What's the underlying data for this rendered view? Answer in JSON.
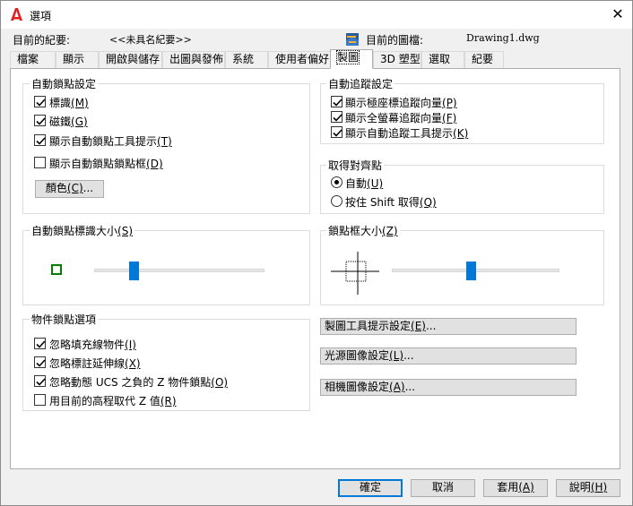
{
  "window": {
    "title": "選項",
    "close_glyph": "✕"
  },
  "header": {
    "profile_label": "目前的紀要:",
    "profile_value": "<<未具名紀要>>",
    "drawing_label": "目前的圖檔:",
    "drawing_value": "Drawing1.dwg"
  },
  "tabs": [
    {
      "label": "檔案"
    },
    {
      "label": "顯示"
    },
    {
      "label": "開啟與儲存"
    },
    {
      "label": "出圖與發佈"
    },
    {
      "label": "系統"
    },
    {
      "label": "使用者偏好"
    },
    {
      "label": "製圖"
    },
    {
      "label": "3D 塑型"
    },
    {
      "label": "選取"
    },
    {
      "label": "紀要"
    }
  ],
  "active_tab": "製圖",
  "autosnap": {
    "title": "自動鎖點設定",
    "options": [
      {
        "text": "標識",
        "key": "(M)",
        "checked": true
      },
      {
        "text": "磁鐵",
        "key": "(G)",
        "checked": true
      },
      {
        "text": "顯示自動鎖點工具提示",
        "key": "(T)",
        "checked": true
      },
      {
        "text": "顯示自動鎖點鎖點框",
        "key": "(D)",
        "checked": false
      }
    ],
    "color_button": {
      "text": "顏色",
      "key": "(C)",
      "suffix": "..."
    }
  },
  "autotrack": {
    "title": "自動追蹤設定",
    "options": [
      {
        "text": "顯示極座標追蹤向量",
        "key": "(P)",
        "checked": true
      },
      {
        "text": "顯示全螢幕追蹤向量",
        "key": "(F)",
        "checked": true
      },
      {
        "text": "顯示自動追蹤工具提示",
        "key": "(K)",
        "checked": true
      }
    ]
  },
  "alignment": {
    "title": "取得對齊點",
    "options": [
      {
        "text": "自動",
        "key": "(U)",
        "selected": true
      },
      {
        "text": "按住 Shift 取得",
        "key": "(Q)",
        "selected": false
      }
    ]
  },
  "marker_size": {
    "title_text": "自動鎖點標識大小",
    "title_key": "(S)",
    "value": 0.23,
    "marker_color": "#008000"
  },
  "aperture_size": {
    "title_text": "鎖點框大小",
    "title_key": "(Z)",
    "value": 0.47
  },
  "osnap": {
    "title": "物件鎖點選項",
    "options": [
      {
        "text": "忽略填充線物件",
        "key": "(I)",
        "checked": true
      },
      {
        "text": "忽略標註延伸線",
        "key": "(X)",
        "checked": true
      },
      {
        "text": "忽略動態 UCS 之負的 Z 物件鎖點",
        "key": "(O)",
        "checked": true
      },
      {
        "text": "用目前的高程取代 Z 值",
        "key": "(R)",
        "checked": false
      }
    ]
  },
  "settings_buttons": [
    {
      "text": "製圖工具提示設定",
      "key": "(E)",
      "suffix": "..."
    },
    {
      "text": "光源圖像設定",
      "key": "(L)",
      "suffix": "..."
    },
    {
      "text": "相機圖像設定",
      "key": "(A)",
      "suffix": "..."
    }
  ],
  "footer": {
    "ok": "確定",
    "cancel": "取消",
    "apply_text": "套用",
    "apply_key": "(A)",
    "help_text": "說明",
    "help_key": "(H)"
  },
  "colors": {
    "accent": "#0078d7",
    "logo_red": "#e51f20"
  }
}
